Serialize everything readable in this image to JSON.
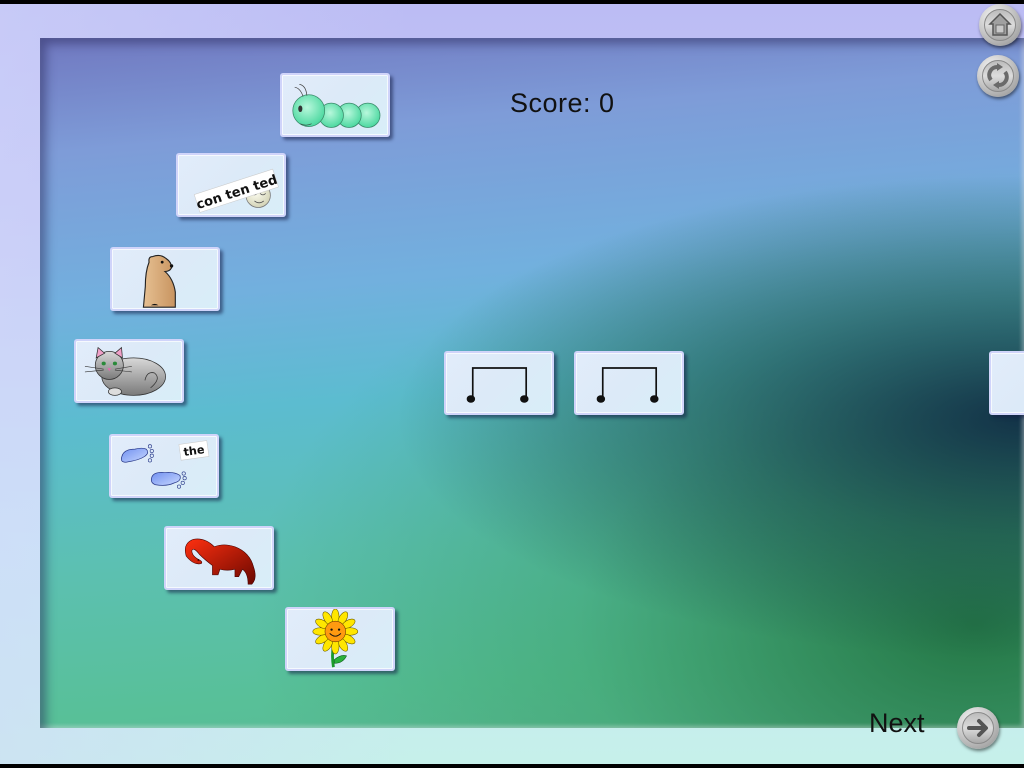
{
  "game": {
    "score_label": "Score:",
    "score_value": "0",
    "next_label": "Next"
  },
  "controls": {
    "home_icon": "home-icon",
    "restart_icon": "refresh-icon",
    "next_icon": "arrow-right-icon"
  },
  "picture_cards": [
    {
      "name": "caterpillar",
      "icon": "caterpillar-icon"
    },
    {
      "name": "contented",
      "icon": "contented-face-icon",
      "word": "con ten ted"
    },
    {
      "name": "groundhog",
      "icon": "groundhog-icon"
    },
    {
      "name": "cat",
      "icon": "cat-icon"
    },
    {
      "name": "the-footprints",
      "icon": "footprints-icon",
      "word": "the"
    },
    {
      "name": "dinosaur",
      "icon": "dinosaur-icon"
    },
    {
      "name": "sunflower",
      "icon": "sunflower-icon"
    }
  ],
  "rhythm_cards": [
    {
      "name": "eighth-note-pair",
      "icon": "eighth-notes-icon"
    },
    {
      "name": "eighth-note-pair",
      "icon": "eighth-notes-icon"
    },
    {
      "name": "partial-card",
      "icon": ""
    }
  ],
  "colors": {
    "card_bg": "#dceaf8",
    "card_border": "#d0d4fa",
    "caterpillar": "#6ee0b0",
    "dinosaur": "#d01800",
    "sunflower_petal": "#ffe600",
    "sunflower_face": "#ff9a10",
    "groundhog": "#d8a878",
    "cat": "#a8a8a8",
    "footprints": "#4a70e0"
  }
}
